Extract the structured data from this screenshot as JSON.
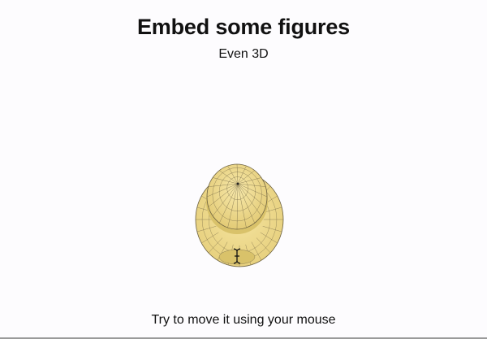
{
  "slide": {
    "title": "Embed some figures",
    "subtitle": "Even 3D",
    "caption": "Try to move it using your mouse"
  },
  "figure": {
    "kind": "3d-surface",
    "shape": "hat",
    "fill_color": "#f0dd8e",
    "shade_color": "#d9c26a",
    "mesh_color": "#6b6040"
  },
  "cursor": {
    "icon": "text-cursor-icon"
  }
}
